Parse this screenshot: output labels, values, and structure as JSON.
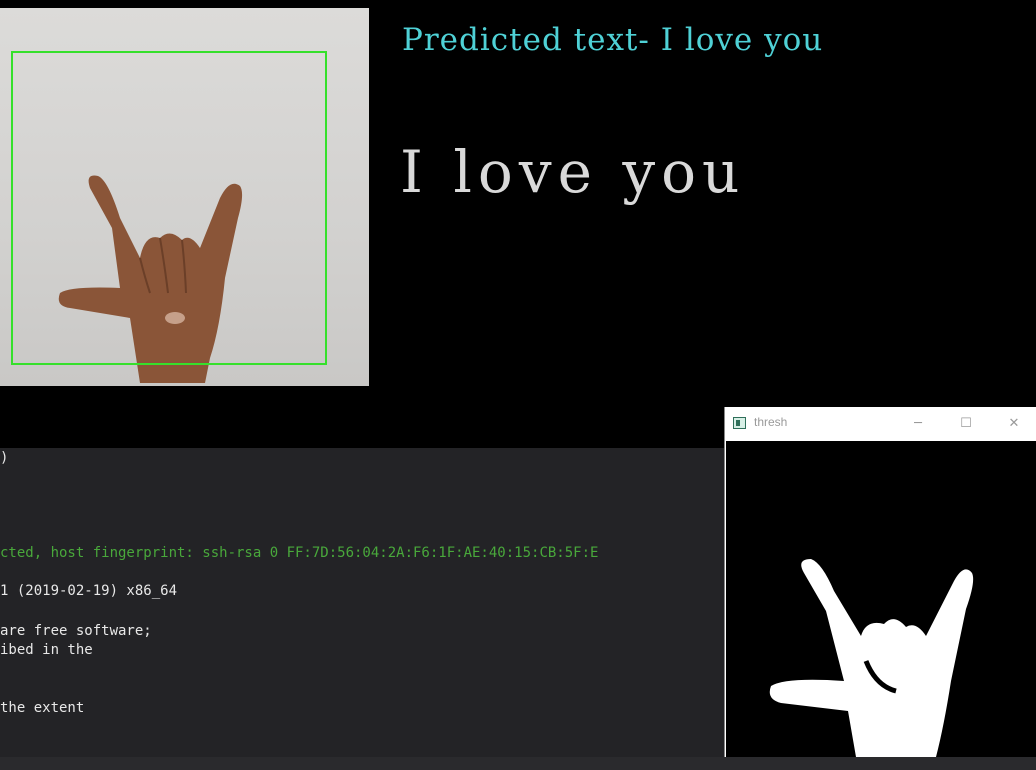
{
  "prediction": {
    "label": "Predicted text- I love you",
    "big_text": "I love you"
  },
  "terminal": {
    "lines": [
      ")",
      "cted, host fingerprint: ssh-rsa 0 FF:7D:56:04:2A:F6:1F:AE:40:15:CB:5F:E",
      "1 (2019-02-19) x86_64",
      "are free software;",
      "ibed in the",
      "the extent"
    ]
  },
  "thresh_window": {
    "title": "thresh",
    "minimize": "─",
    "maximize": "☐",
    "close": "✕"
  },
  "colors": {
    "roi_box": "#35e02b",
    "label_cyan": "#4fd1d6",
    "terminal_green": "#49a83b",
    "terminal_bg": "#232326"
  }
}
